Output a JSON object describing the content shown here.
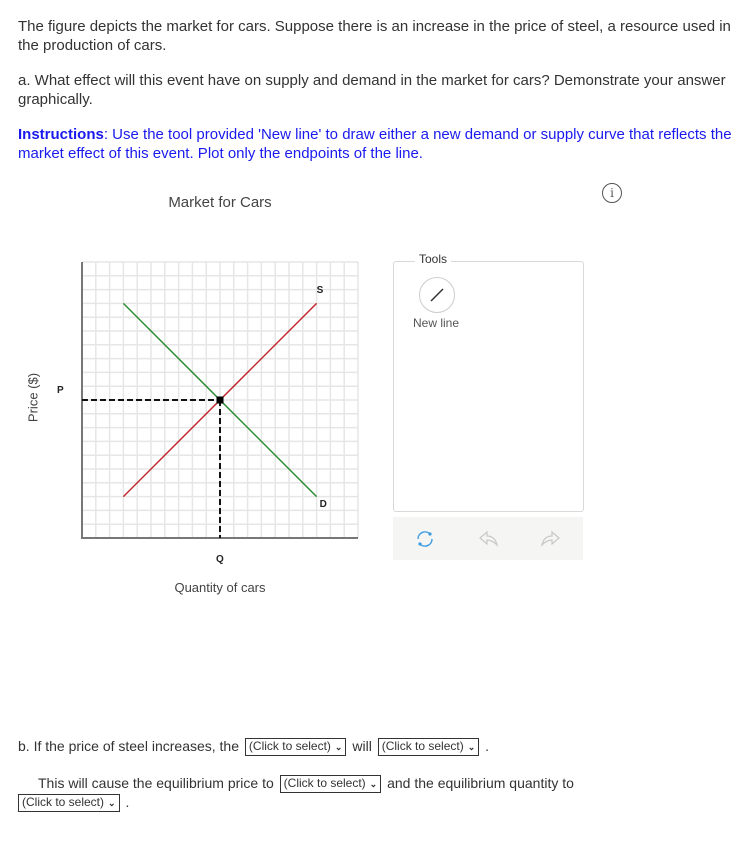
{
  "question": {
    "intro": "The figure depicts the market for cars. Suppose there is an increase in the price of steel, a resource used in the production of cars.",
    "part_a": "a. What effect will this event have on supply and demand in the market for cars? Demonstrate your answer graphically.",
    "instructions_label": "Instructions",
    "instructions_text": ": Use the tool provided 'New line' to draw either a new demand or supply curve that reflects the market effect of this event. Plot only the endpoints of the line."
  },
  "info_icon": "i",
  "chart_data": {
    "type": "line",
    "title": "Market for Cars",
    "xlabel": "Quantity of cars",
    "ylabel": "Price ($)",
    "xlim": [
      0,
      20
    ],
    "ylim": [
      0,
      20
    ],
    "grid": true,
    "series": [
      {
        "name": "S",
        "color": "#c0282d",
        "points": [
          [
            3,
            3
          ],
          [
            17,
            17
          ]
        ]
      },
      {
        "name": "D",
        "color": "#2e8b2e",
        "points": [
          [
            3,
            17
          ],
          [
            17,
            3
          ]
        ]
      }
    ],
    "equilibrium": {
      "x": 10,
      "y": 10,
      "x_label": "Q",
      "y_label": "P"
    }
  },
  "tools": {
    "legend": "Tools",
    "new_line_label": "New line",
    "reset_icon": "reset-icon",
    "undo_icon": "undo-icon",
    "redo_icon": "redo-icon"
  },
  "part_b": {
    "text1": "b. If the price of steel increases, the",
    "text2": "will",
    "text3": ".",
    "text4": "This will cause the equilibrium price to",
    "text5": "and the equilibrium quantity to",
    "text6": ".",
    "select_placeholder": "(Click to select)"
  }
}
